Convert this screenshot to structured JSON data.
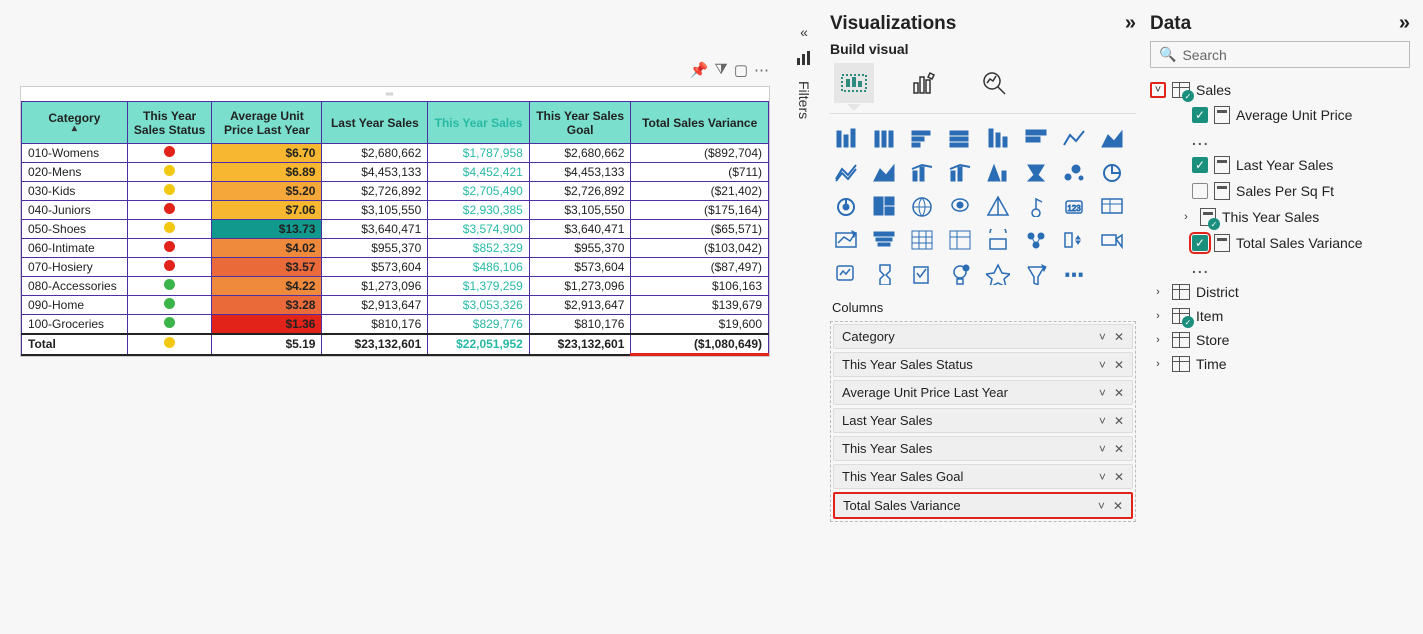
{
  "panes": {
    "filters_label": "Filters",
    "viz_title": "Visualizations",
    "build_label": "Build visual",
    "columns_label": "Columns",
    "data_title": "Data",
    "search_placeholder": "Search"
  },
  "table": {
    "headers": {
      "category": "Category",
      "status": "This Year Sales Status",
      "aup": "Average Unit Price Last Year",
      "ly": "Last Year Sales",
      "ty": "This Year Sales",
      "goal": "This Year Sales Goal",
      "var": "Total Sales Variance"
    },
    "rows": [
      {
        "cat": "010-Womens",
        "dot": "red",
        "aup": "$6.70",
        "aupcls": "aup-1",
        "ly": "$2,680,662",
        "ty": "$1,787,958",
        "goal": "$2,680,662",
        "var": "($892,704)"
      },
      {
        "cat": "020-Mens",
        "dot": "yellow",
        "aup": "$6.89",
        "aupcls": "aup-1",
        "ly": "$4,453,133",
        "ty": "$4,452,421",
        "goal": "$4,453,133",
        "var": "($711)"
      },
      {
        "cat": "030-Kids",
        "dot": "yellow",
        "aup": "$5.20",
        "aupcls": "aup-2",
        "ly": "$2,726,892",
        "ty": "$2,705,490",
        "goal": "$2,726,892",
        "var": "($21,402)"
      },
      {
        "cat": "040-Juniors",
        "dot": "red",
        "aup": "$7.06",
        "aupcls": "aup-1",
        "ly": "$3,105,550",
        "ty": "$2,930,385",
        "goal": "$3,105,550",
        "var": "($175,164)"
      },
      {
        "cat": "050-Shoes",
        "dot": "yellow",
        "aup": "$13.73",
        "aupcls": "aup-teal",
        "ly": "$3,640,471",
        "ty": "$3,574,900",
        "goal": "$3,640,471",
        "var": "($65,571)"
      },
      {
        "cat": "060-Intimate",
        "dot": "red",
        "aup": "$4.02",
        "aupcls": "aup-3",
        "ly": "$955,370",
        "ty": "$852,329",
        "goal": "$955,370",
        "var": "($103,042)"
      },
      {
        "cat": "070-Hosiery",
        "dot": "red",
        "aup": "$3.57",
        "aupcls": "aup-4",
        "ly": "$573,604",
        "ty": "$486,106",
        "goal": "$573,604",
        "var": "($87,497)"
      },
      {
        "cat": "080-Accessories",
        "dot": "green",
        "aup": "$4.22",
        "aupcls": "aup-3",
        "ly": "$1,273,096",
        "ty": "$1,379,259",
        "goal": "$1,273,096",
        "var": "$106,163"
      },
      {
        "cat": "090-Home",
        "dot": "green",
        "aup": "$3.28",
        "aupcls": "aup-4",
        "ly": "$2,913,647",
        "ty": "$3,053,326",
        "goal": "$2,913,647",
        "var": "$139,679"
      },
      {
        "cat": "100-Groceries",
        "dot": "green",
        "aup": "$1.36",
        "aupcls": "aup-5",
        "ly": "$810,176",
        "ty": "$829,776",
        "goal": "$810,176",
        "var": "$19,600"
      }
    ],
    "total": {
      "label": "Total",
      "dot": "yellow",
      "aup": "$5.19",
      "ly": "$23,132,601",
      "ty": "$22,051,952",
      "goal": "$23,132,601",
      "var": "($1,080,649)"
    }
  },
  "column_pills": [
    "Category",
    "This Year Sales Status",
    "Average Unit Price Last Year",
    "Last Year Sales",
    "This Year Sales",
    "This Year Sales Goal",
    "Total Sales Variance"
  ],
  "data_tree": {
    "sales": "Sales",
    "avg_unit_price": "Average Unit Price",
    "ellipsis": "...",
    "last_year_sales": "Last Year Sales",
    "sales_per_sqft": "Sales Per Sq Ft",
    "this_year_sales": "This Year Sales",
    "total_sales_variance": "Total Sales Variance",
    "district": "District",
    "item": "Item",
    "store": "Store",
    "time": "Time"
  }
}
